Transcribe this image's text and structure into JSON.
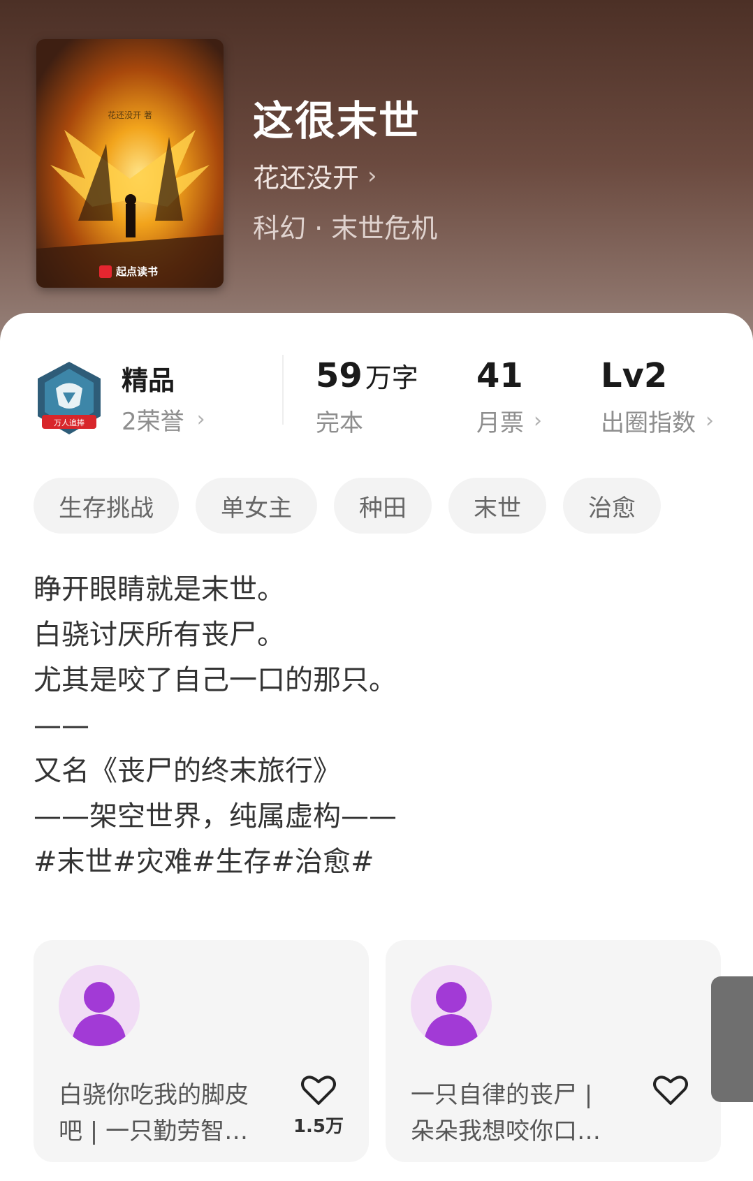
{
  "book": {
    "title": "这很末世",
    "author": "花还没开",
    "genre": "科幻 · 末世危机",
    "cover_author": "花还没开 著",
    "cover_brand": "起点读书"
  },
  "stats": {
    "quality_label": "精品",
    "honor": "2荣誉",
    "badge_text": "万人追捧",
    "word_count": "59",
    "word_unit": "万字",
    "status": "完本",
    "monthly_votes": "41",
    "monthly_votes_label": "月票",
    "circle_level": "Lv2",
    "circle_label": "出圈指数"
  },
  "tags": [
    "生存挑战",
    "单女主",
    "种田",
    "末世",
    "治愈"
  ],
  "description": [
    "睁开眼睛就是末世。",
    "白骁讨厌所有丧尸。",
    "尤其是咬了自己一口的那只。",
    "——",
    "又名《丧尸的终末旅行》",
    "——架空世界，纯属虚构——",
    "#末世#灾难#生存#治愈#"
  ],
  "reviews": [
    {
      "line1": "白骁你吃我的脚皮",
      "line2": "吧 | 一只勤劳智…",
      "likes": "1.5万"
    },
    {
      "line1": "一只自律的丧尸 |",
      "line2": "朵朵我想咬你口…",
      "likes": ""
    }
  ],
  "colors": {
    "hero_top": "#4c3026",
    "tag_bg": "#f3f3f3",
    "avatar_bg": "#f1dcf5",
    "avatar_fg": "#a23ad6"
  }
}
